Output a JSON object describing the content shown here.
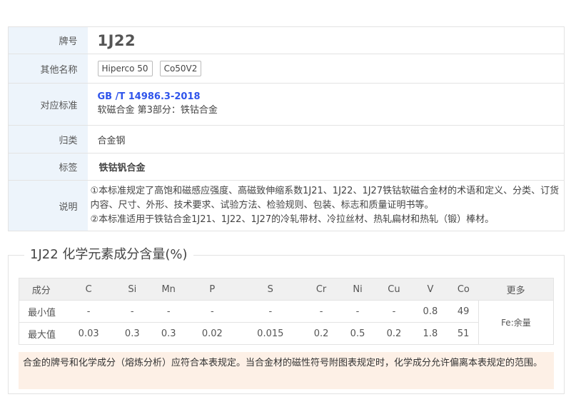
{
  "info": {
    "grade_label": "牌号",
    "grade_value": "1J22",
    "alias_label": "其他名称",
    "aliases": [
      "Hiperco 50",
      "Co50V2"
    ],
    "standard_label": "对应标准",
    "standard_code": "GB /T 14986.3-2018",
    "standard_name": "软磁合金 第3部分：铁钴合金",
    "category_label": "归类",
    "category_value": "合金钢",
    "tag_label": "标签",
    "tag_value": "铁钴钒合金",
    "desc_label": "说明",
    "desc_line1": "①本标准规定了高饱和磁感应强度、高磁致伸缩系数1J21、1J22、1J27铁钴软磁合金材的术语和定义、分类、订货内容、尺寸、外形、技术要求、试验方法、检验规则、包装、标志和质量证明书等。",
    "desc_line2": "②本标准适用于铁钴合金1J21、1J22、1J27的冷轧带材、冷拉丝材、热轧扁材和热轧（锻）棒材。"
  },
  "chem": {
    "title": "1J22 化学元素成分含量(%)",
    "header": [
      "成分",
      "C",
      "Si",
      "Mn",
      "P",
      "S",
      "Cr",
      "Ni",
      "Cu",
      "V",
      "Co",
      "更多"
    ],
    "min_label": "最小值",
    "min_values": [
      "-",
      "-",
      "-",
      "-",
      "-",
      "-",
      "-",
      "-",
      "0.8",
      "49"
    ],
    "max_label": "最大值",
    "max_values": [
      "0.03",
      "0.3",
      "0.3",
      "0.02",
      "0.015",
      "0.2",
      "0.5",
      "0.2",
      "1.8",
      "51"
    ],
    "more_value": "Fe:余量",
    "note": "合金的牌号和化学成分（熔炼分析）应符合本表规定。当合金材的磁性符号附图表规定时，化学成分允许偏离本表规定的范围。"
  }
}
